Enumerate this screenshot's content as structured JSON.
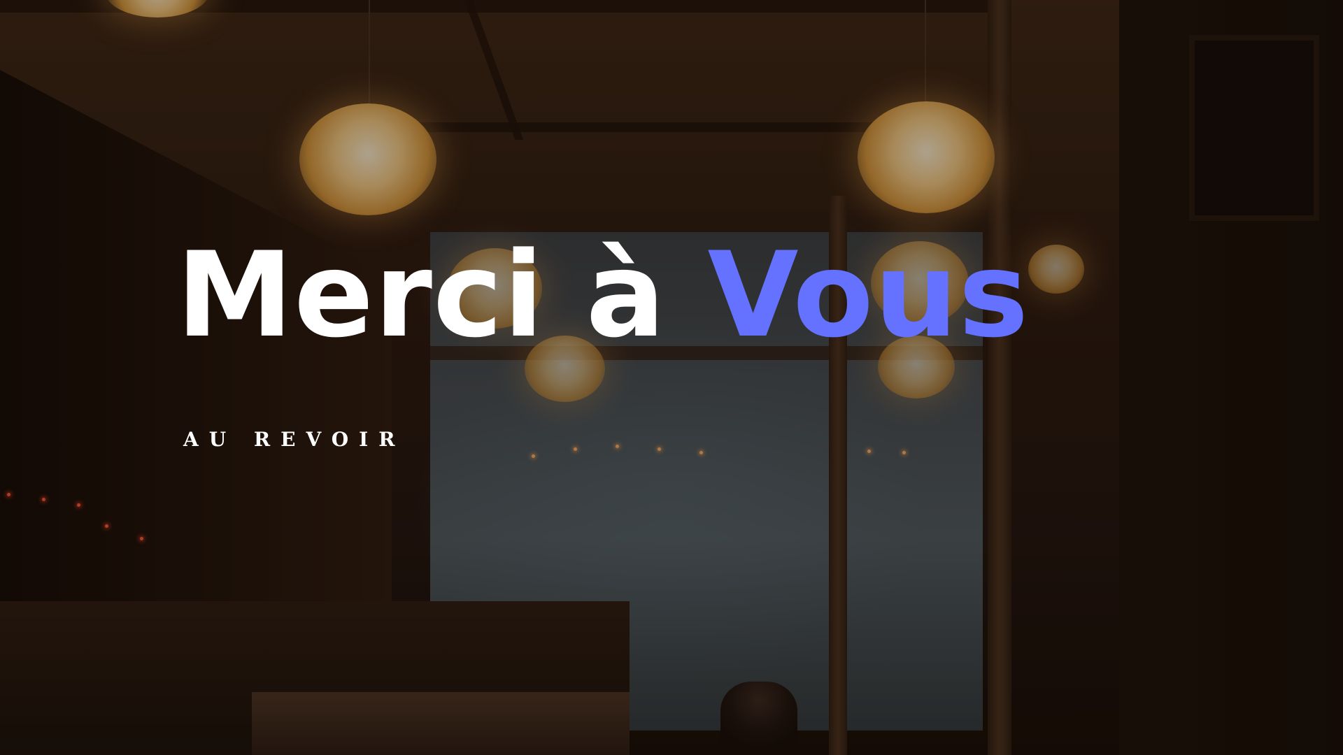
{
  "slide": {
    "title_part1": "Merci à ",
    "title_part2": "Vous",
    "subtitle": "AU REVOIR"
  },
  "colors": {
    "title_primary": "#ffffff",
    "title_accent": "#6571ff",
    "subtitle": "#ffffff"
  }
}
